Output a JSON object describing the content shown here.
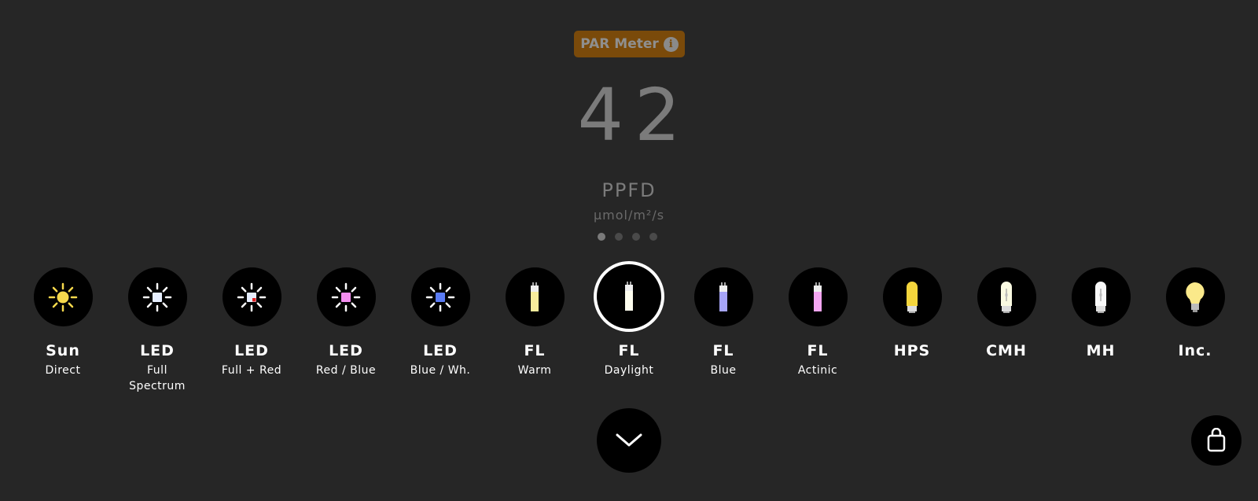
{
  "header": {
    "badge_label": "PAR Meter",
    "info_icon": "i"
  },
  "reading": {
    "value": "42",
    "unit_name": "PPFD",
    "unit": "μmol/m²/s"
  },
  "pager": {
    "count": 4,
    "active_index": 0
  },
  "lights": [
    {
      "name": "Sun",
      "sub": "Direct",
      "icon": "sun-icon",
      "color": "#f7d94c",
      "selected": false
    },
    {
      "name": "LED",
      "sub": "Full Spectrum",
      "icon": "led-full-spectrum-icon",
      "color": "#e6eeff",
      "selected": false
    },
    {
      "name": "LED",
      "sub": "Full + Red",
      "icon": "led-full-red-icon",
      "color": "#e6eeff",
      "accent": "#e02020",
      "selected": false
    },
    {
      "name": "LED",
      "sub": "Red / Blue",
      "icon": "led-red-blue-icon",
      "color": "#f48ef0",
      "selected": false
    },
    {
      "name": "LED",
      "sub": "Blue / Wh.",
      "icon": "led-blue-white-icon",
      "color": "#5b7cf5",
      "selected": false
    },
    {
      "name": "FL",
      "sub": "Warm",
      "icon": "fluorescent-tube-warm-icon",
      "color": "#f8ec9c",
      "selected": false
    },
    {
      "name": "FL",
      "sub": "Daylight",
      "icon": "fluorescent-tube-daylight-icon",
      "color": "#fcfcee",
      "selected": true
    },
    {
      "name": "FL",
      "sub": "Blue",
      "icon": "fluorescent-tube-blue-icon",
      "color": "#a6a4f8",
      "selected": false
    },
    {
      "name": "FL",
      "sub": "Actinic",
      "icon": "fluorescent-tube-actinic-icon",
      "color": "#f4a6f2",
      "selected": false
    },
    {
      "name": "HPS",
      "sub": "",
      "icon": "hps-bulb-icon",
      "color": "#f4d53c",
      "selected": false
    },
    {
      "name": "CMH",
      "sub": "",
      "icon": "cmh-bulb-icon",
      "color": "#fafae2",
      "selected": false
    },
    {
      "name": "MH",
      "sub": "",
      "icon": "mh-bulb-icon",
      "color": "#f8f8f8",
      "selected": false
    },
    {
      "name": "Inc.",
      "sub": "",
      "icon": "incandescent-bulb-icon",
      "color": "#fae98a",
      "selected": false
    }
  ],
  "buttons": {
    "expand_icon": "chevron-down-icon",
    "shop_icon": "shopping-bag-icon"
  },
  "colors": {
    "background": "#262626",
    "badge": "#7a4a0a",
    "text_muted": "#7b7b7b"
  }
}
